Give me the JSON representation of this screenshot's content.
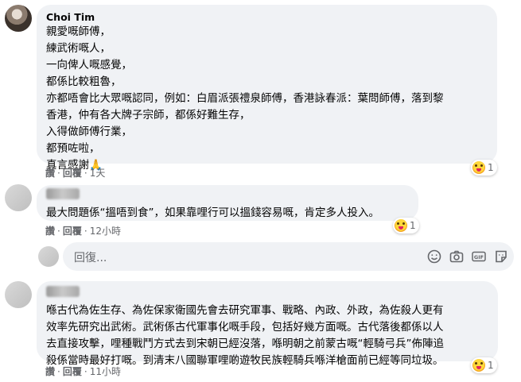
{
  "comments": [
    {
      "author": "Choi Tim",
      "lines": [
        "親愛嘅師傅，",
        "練武術嘅人，",
        "一向俾人嘅感覺，",
        "都係比較粗魯，",
        "亦都唔會比大眾嘅認同，例如：白眉派張禮泉師傅，香港詠春派：葉問師傅，落到黎",
        "香港，仲有各大牌子宗師，都係好難生存，",
        "入得做師傅行業，",
        "都預咗啦，",
        "真言感謝🙏"
      ],
      "like": "讚",
      "reply": "回覆",
      "time": "1天",
      "reaction_count": "1"
    },
    {
      "author": "",
      "lines": [
        "最大問題係“搵唔到食”，如果靠哩行可以搵錢容易嘅，肯定多人投入。"
      ],
      "like": "讚",
      "reply": "回覆",
      "time": "12小時",
      "reaction_count": "1"
    },
    {
      "author": "",
      "lines": [
        "喺古代為佐生存、為佐保家衛國先會去研究軍事、戰略、內政、外政，為佐殺人更有",
        "效率先研究出武術。武術係古代軍事化嘅手段，包括好幾方面嘅。古代落後都係以人",
        "去直接攻擊，哩種戰鬥方式去到宋朝已經沒落，喺明朝之前蒙古嘅“輕騎弓兵”佈陣追",
        "殺係當時最好打嘅。到清末八國聯軍哩啲遊牧民族輕騎兵喺洋槍面前已經等同垃圾。"
      ],
      "like": "讚",
      "reply": "回覆",
      "time": "11小時",
      "reaction_count": "1"
    }
  ],
  "reply_box": {
    "placeholder": "回復..."
  },
  "icons": [
    "emoji-icon",
    "camera-icon",
    "gif-icon",
    "sticker-icon"
  ]
}
